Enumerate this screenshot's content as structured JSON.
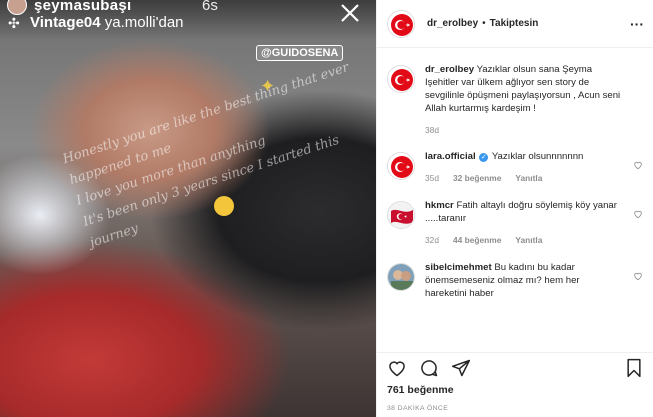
{
  "story": {
    "username": "şeymasubaşı",
    "time": "6s",
    "music_title": "Vintage04",
    "music_artist": "ya.molli'dan",
    "tag": "@GUIDOSENA",
    "script_lines": [
      "Honestly you are like the best thing that ever happened to me",
      "I love you more than anything",
      "It's been only 3 years since I started this journey"
    ]
  },
  "post": {
    "username": "dr_erolbey",
    "separator": "•",
    "follow_status": "Takiptesin",
    "caption_user": "dr_erolbey",
    "caption_text": "Yazıklar olsun sana Şeyma Işehitler var ülkem ağlıyor sen story de sevgilinle öpüşmeni paylaşıyorsun , Acun seni Allah kurtarmış kardeşim !",
    "caption_time": "38d",
    "comments": [
      {
        "user": "lara.official",
        "verified": true,
        "text": "Yazıklar olsunnnnnnn",
        "time": "35d",
        "likes": "32 beğenme",
        "reply": "Yanıtla"
      },
      {
        "user": "hkmcr",
        "verified": false,
        "text": "Fatih altaylı doğru söylemiş köy yanar .....taranır",
        "time": "32d",
        "likes": "44 beğenme",
        "reply": "Yanıtla"
      },
      {
        "user": "sibelcimehmet",
        "verified": false,
        "text": "Bu kadını bu kadar önemsemeseniz olmaz mı? hem her hareketini haber",
        "time": "",
        "likes": "",
        "reply": ""
      }
    ],
    "likes_count": "761 beğenme",
    "time_ago": "38 DAKİKA ÖNCE"
  },
  "colors": {
    "turkish_red": "#e30a17",
    "muted": "#8e8e8e",
    "verified_blue": "#3897f0"
  }
}
